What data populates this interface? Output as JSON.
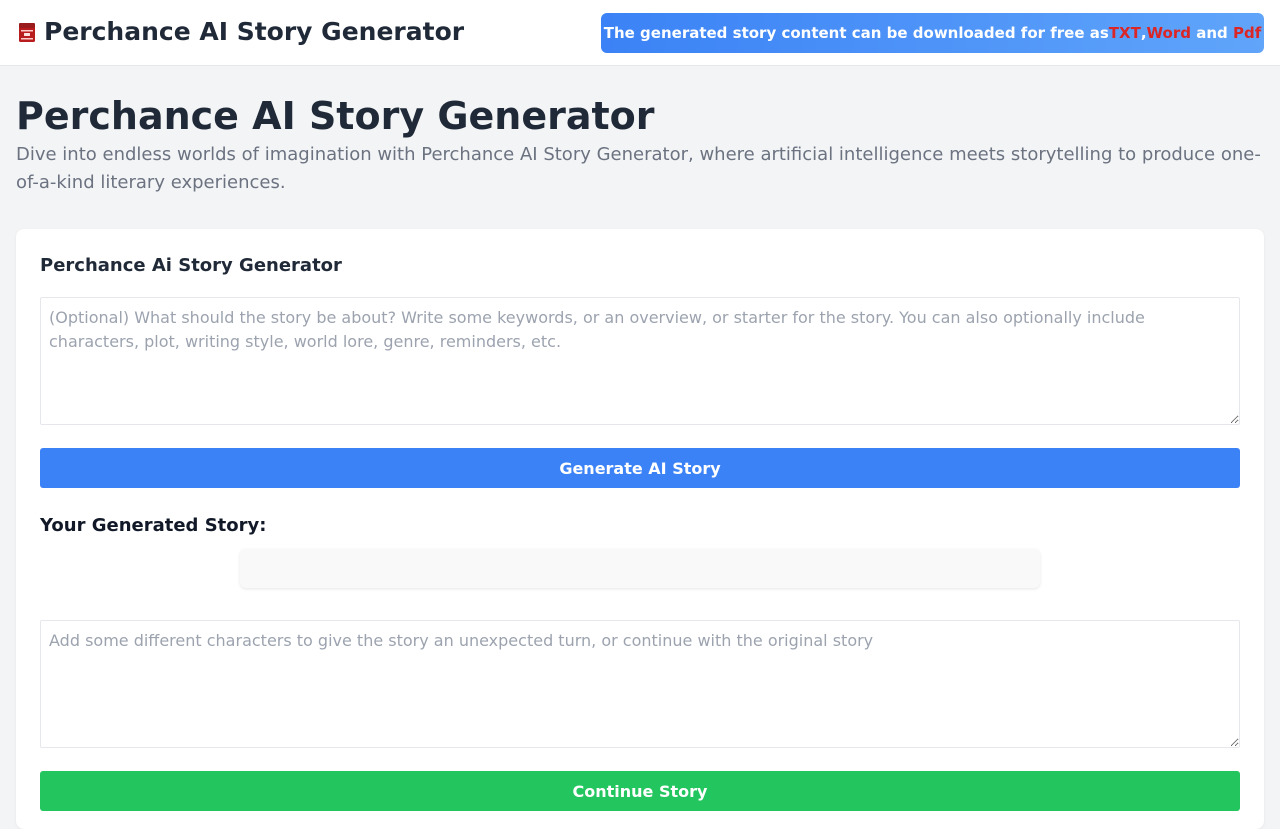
{
  "header": {
    "brand_icon": "book-icon",
    "title": "Perchance AI Story Generator",
    "promo": {
      "text_before": "The generated story content can be downloaded for free as ",
      "format_txt": "TXT",
      "separator": ",",
      "format_word": "Word",
      "text_and": " and ",
      "format_pdf": "Pdf",
      "accent_color": "#dc2626"
    }
  },
  "hero": {
    "title": "Perchance AI Story Generator",
    "description": "Dive into endless worlds of imagination with Perchance AI Story Generator, where artificial intelligence meets storytelling to produce one-of-a-kind literary experiences."
  },
  "generator": {
    "title": "Perchance Ai Story Generator",
    "prompt_placeholder": "(Optional) What should the story be about? Write some keywords, or an overview, or starter for the story. You can also optionally include characters, plot, writing style, world lore, genre, reminders, etc.",
    "prompt_value": "",
    "generate_label": "Generate AI Story",
    "result_label": "Your Generated Story:",
    "story_output": "",
    "continue_placeholder": "Add some different characters to give the story an unexpected turn, or continue with the original story",
    "continue_value": "",
    "continue_label": "Continue Story"
  },
  "colors": {
    "primary": "#3b82f6",
    "success": "#22c55e",
    "background": "#f3f4f6"
  }
}
